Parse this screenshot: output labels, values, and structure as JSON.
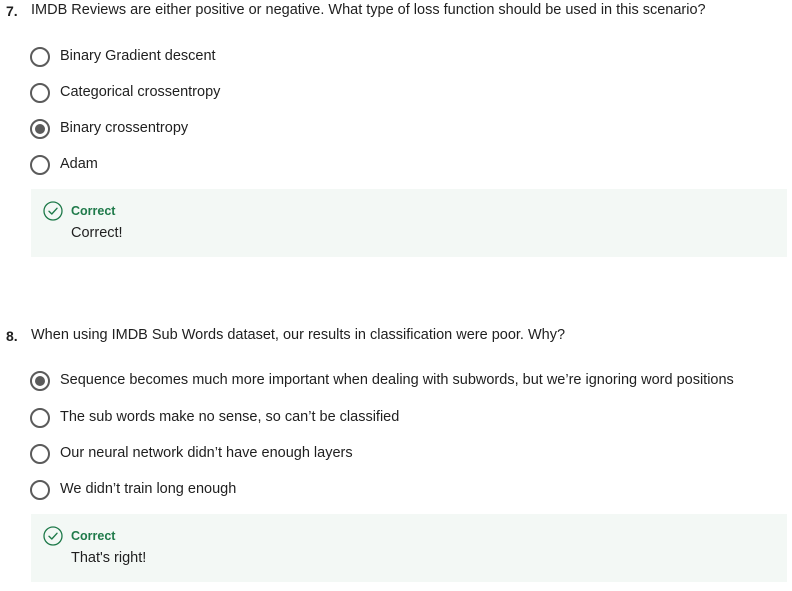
{
  "questions": [
    {
      "number": "7.",
      "text": "IMDB Reviews are either positive or negative. What type of loss function should be used in this scenario?",
      "options": [
        {
          "label": "Binary Gradient descent",
          "selected": false
        },
        {
          "label": "Categorical crossentropy",
          "selected": false
        },
        {
          "label": "Binary crossentropy",
          "selected": true
        },
        {
          "label": "Adam",
          "selected": false
        }
      ],
      "feedback": {
        "status": "Correct",
        "message": "Correct!",
        "icon": "check-circle-icon"
      }
    },
    {
      "number": "8.",
      "text": "When using IMDB Sub Words dataset, our results in classification were poor. Why?",
      "options": [
        {
          "label": "Sequence becomes much more important when dealing with subwords, but we’re ignoring word positions",
          "selected": true
        },
        {
          "label": "The sub words make no sense, so can’t be classified",
          "selected": false
        },
        {
          "label": "Our neural network didn’t have enough layers",
          "selected": false
        },
        {
          "label": "We didn’t train long enough",
          "selected": false
        }
      ],
      "feedback": {
        "status": "Correct",
        "message": "That's right!",
        "icon": "check-circle-icon"
      }
    }
  ],
  "colors": {
    "radio_border": "#5b5b5b",
    "feedback_bg": "#f3f8f5",
    "correct_green": "#1f7a4a"
  }
}
